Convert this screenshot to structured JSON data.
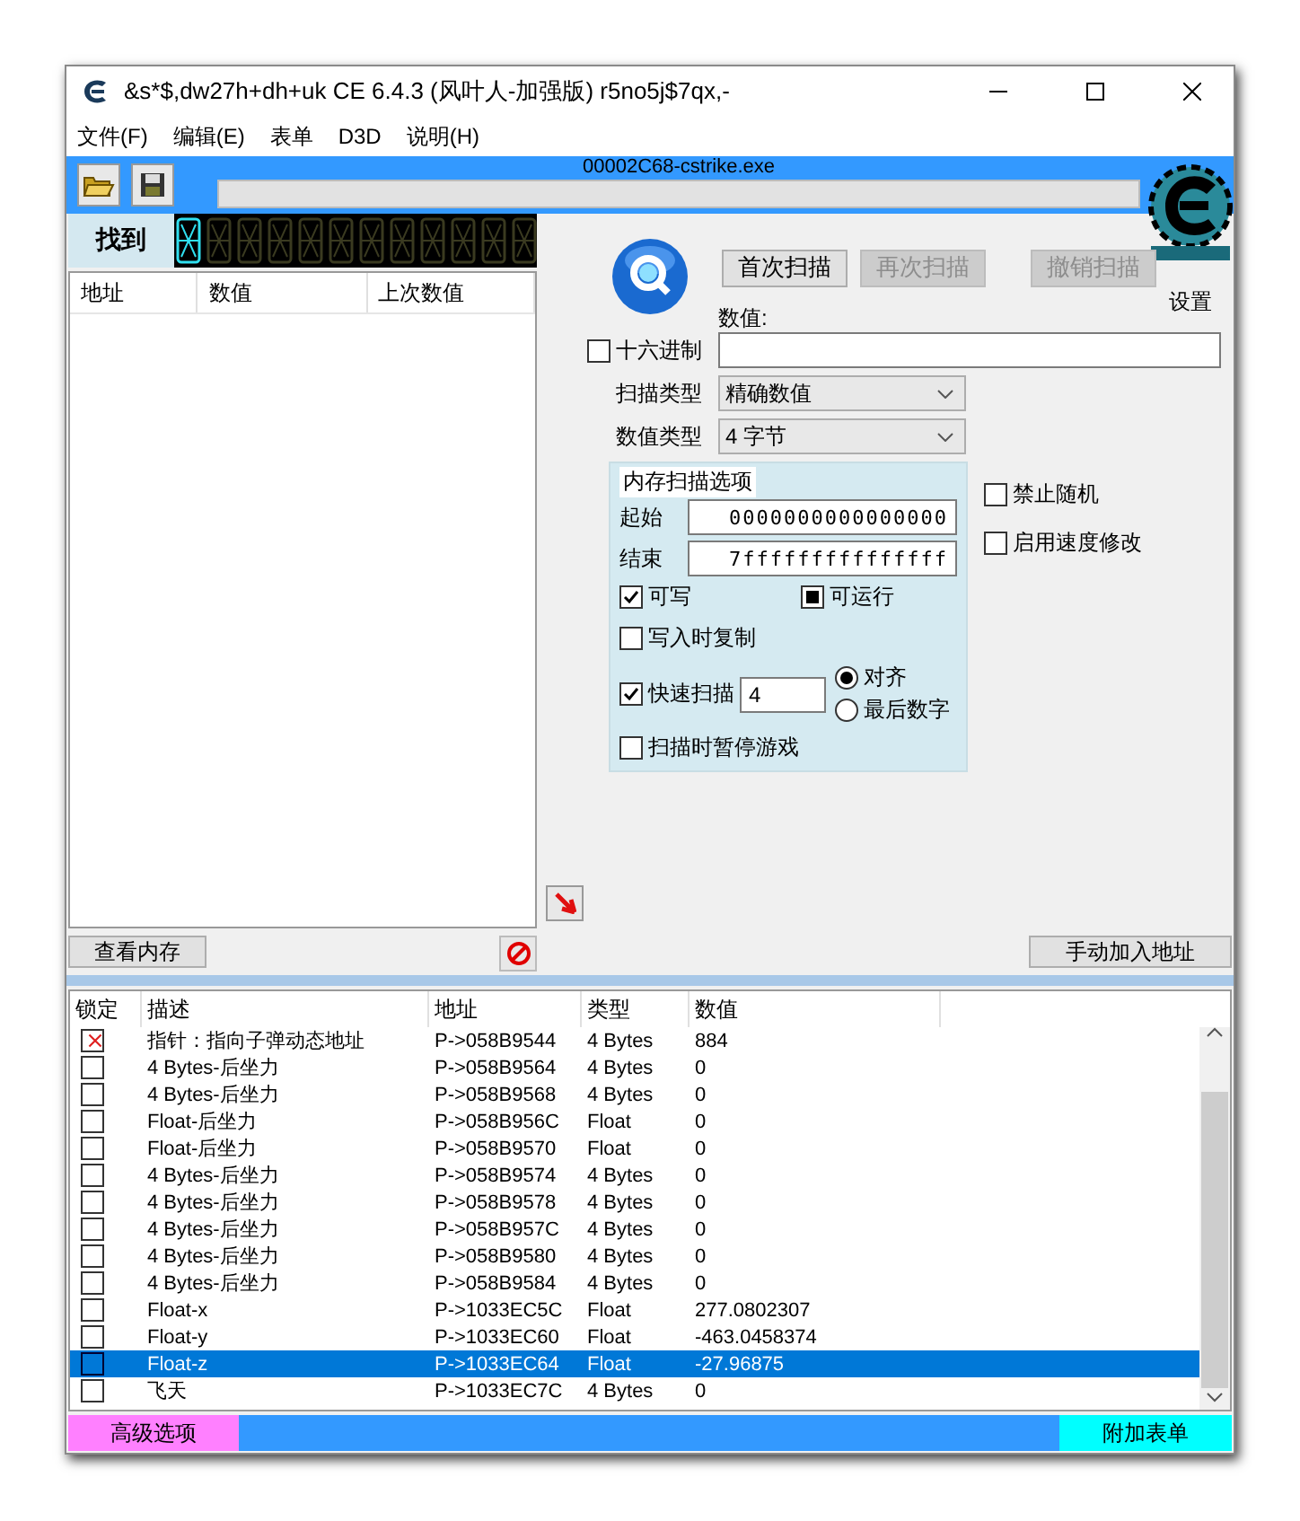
{
  "window": {
    "title": "&s*$,dw27h+dh+uk  CE 6.4.3 (风叶人-加强版)  r5no5j$7qx,-"
  },
  "menu": [
    "文件(F)",
    "编辑(E)",
    "表单",
    "D3D",
    "说明(H)"
  ],
  "process": "00002C68-cstrike.exe",
  "scan_progress": {
    "level": 0
  },
  "logo_caption": "设置",
  "found": {
    "label": "找到",
    "columns": [
      "地址",
      "数值",
      "上次数值"
    ]
  },
  "scan_buttons": [
    {
      "label": "首次扫描",
      "disabled": false
    },
    {
      "label": "再次扫描",
      "disabled": true
    },
    {
      "label": "撤销扫描",
      "disabled": true
    }
  ],
  "value": {
    "label": "数值:",
    "hex": {
      "label": "十六进制",
      "checked": false
    }
  },
  "scan_type": {
    "label": "扫描类型",
    "value": "精确数值"
  },
  "value_type": {
    "label": "数值类型",
    "value": "4 字节"
  },
  "memory_options": {
    "title": "内存扫描选项",
    "start": {
      "label": "起始",
      "value": "0000000000000000"
    },
    "end": {
      "label": "结束",
      "value": "7fffffffffffffff"
    },
    "writable": {
      "label": "可写",
      "checked": true
    },
    "executable": {
      "label": "可运行",
      "indeterminate": true
    },
    "copy_on_write": {
      "label": "写入时复制",
      "checked": false
    },
    "fast_scan": {
      "label": "快速扫描",
      "checked": true,
      "value": "4"
    },
    "alignment": [
      {
        "label": "对齐",
        "selected": true
      },
      {
        "label": "最后数字",
        "selected": false
      }
    ],
    "pause": {
      "label": "扫描时暂停游戏",
      "checked": false
    }
  },
  "side_options": [
    {
      "label": "禁止随机",
      "checked": false
    },
    {
      "label": "启用速度修改",
      "checked": false
    }
  ],
  "view_memory": "查看内存",
  "add_address": "手动加入地址",
  "table": {
    "columns": [
      "锁定",
      "描述",
      "地址",
      "类型",
      "数值"
    ],
    "rows": [
      {
        "locked": true,
        "selected": false,
        "description": "指针：指向子弹动态地址",
        "address": "P->058B9544",
        "type": "4 Bytes",
        "value": "884"
      },
      {
        "locked": false,
        "selected": false,
        "description": "4 Bytes-后坐力",
        "address": "P->058B9564",
        "type": "4 Bytes",
        "value": "0"
      },
      {
        "locked": false,
        "selected": false,
        "description": "4 Bytes-后坐力",
        "address": "P->058B9568",
        "type": "4 Bytes",
        "value": "0"
      },
      {
        "locked": false,
        "selected": false,
        "description": "Float-后坐力",
        "address": "P->058B956C",
        "type": "Float",
        "value": "0"
      },
      {
        "locked": false,
        "selected": false,
        "description": "Float-后坐力",
        "address": "P->058B9570",
        "type": "Float",
        "value": "0"
      },
      {
        "locked": false,
        "selected": false,
        "description": "4 Bytes-后坐力",
        "address": "P->058B9574",
        "type": "4 Bytes",
        "value": "0"
      },
      {
        "locked": false,
        "selected": false,
        "description": "4 Bytes-后坐力",
        "address": "P->058B9578",
        "type": "4 Bytes",
        "value": "0"
      },
      {
        "locked": false,
        "selected": false,
        "description": "4 Bytes-后坐力",
        "address": "P->058B957C",
        "type": "4 Bytes",
        "value": "0"
      },
      {
        "locked": false,
        "selected": false,
        "description": "4 Bytes-后坐力",
        "address": "P->058B9580",
        "type": "4 Bytes",
        "value": "0"
      },
      {
        "locked": false,
        "selected": false,
        "description": "4 Bytes-后坐力",
        "address": "P->058B9584",
        "type": "4 Bytes",
        "value": "0"
      },
      {
        "locked": false,
        "selected": false,
        "description": "Float-x",
        "address": "P->1033EC5C",
        "type": "Float",
        "value": "277.0802307"
      },
      {
        "locked": false,
        "selected": false,
        "description": "Float-y",
        "address": "P->1033EC60",
        "type": "Float",
        "value": "-463.0458374"
      },
      {
        "locked": false,
        "selected": true,
        "description": "Float-z",
        "address": "P->1033EC64",
        "type": "Float",
        "value": "-27.96875"
      },
      {
        "locked": false,
        "selected": false,
        "description": "飞天",
        "address": "P->1033EC7C",
        "type": "4 Bytes",
        "value": "0"
      }
    ]
  },
  "footer": {
    "left": "高级选项",
    "right": "附加表单"
  }
}
